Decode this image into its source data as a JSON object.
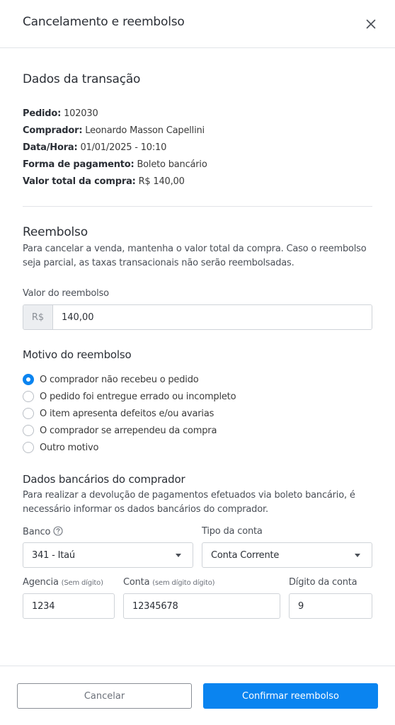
{
  "header": {
    "title": "Cancelamento e reembolso",
    "close_icon": "close-icon"
  },
  "transaction": {
    "title": "Dados da transação",
    "fields": [
      {
        "label": "Pedido:",
        "value": "102030"
      },
      {
        "label": "Comprador:",
        "value": "Leonardo Masson Capellini"
      },
      {
        "label": "Data/Hora:",
        "value": "01/01/2025 - 10:10"
      },
      {
        "label": "Forma de pagamento:",
        "value": "Boleto bancário"
      },
      {
        "label": "Valor total da compra:",
        "value": "R$ 140,00"
      }
    ]
  },
  "refund": {
    "title": "Reembolso",
    "description": "Para cancelar a venda, mantenha o valor total da compra. Caso o reembolso seja parcial, as taxas transacionais não serão reembolsadas.",
    "amount_label": "Valor do reembolso",
    "currency_prefix": "R$",
    "amount_value": "140,00"
  },
  "reason": {
    "title": "Motivo do reembolso",
    "options": [
      {
        "label": "O comprador não recebeu o pedido",
        "checked": true
      },
      {
        "label": "O pedido foi entregue errado ou incompleto",
        "checked": false
      },
      {
        "label": "O item apresenta defeitos e/ou avarias",
        "checked": false
      },
      {
        "label": "O comprador se arrependeu da compra",
        "checked": false
      },
      {
        "label": "Outro motivo",
        "checked": false
      }
    ]
  },
  "bank": {
    "title": "Dados bancários do comprador",
    "description": "Para realizar a devolução de pagamentos efetuados via boleto bancário, é necessário informar os dados bancários do comprador.",
    "bank_label": "Banco",
    "bank_value": "341 - Itaú",
    "account_type_label": "Tipo da conta",
    "account_type_value": "Conta Corrente",
    "agency_label": "Agencia",
    "agency_hint": "(Sem dígito)",
    "agency_value": "1234",
    "account_label": "Conta",
    "account_hint": "(sem dígito dígito)",
    "account_value": "12345678",
    "digit_label": "Dígito da conta",
    "digit_value": "9"
  },
  "footer": {
    "cancel_label": "Cancelar",
    "confirm_label": "Confirmar reembolso"
  },
  "colors": {
    "accent": "#0a84f0",
    "border": "#cfd3d8",
    "divider": "#e2e4e8",
    "prefix_bg": "#eceef1"
  }
}
